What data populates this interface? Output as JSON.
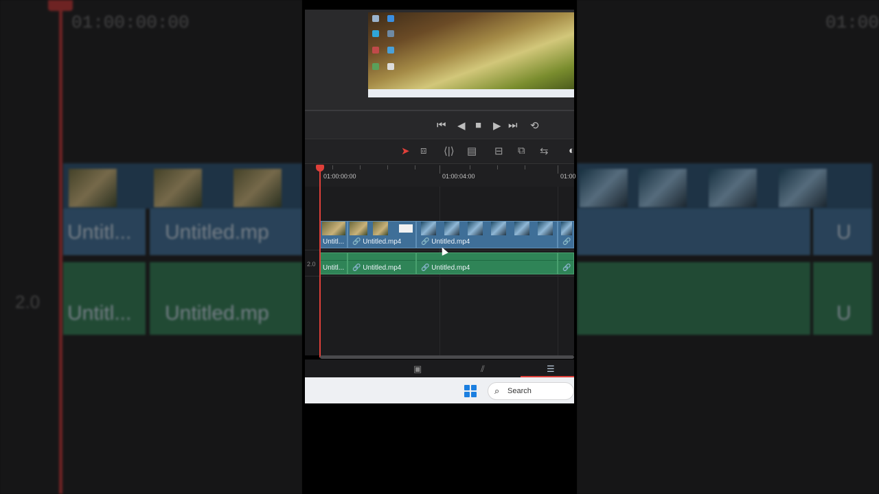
{
  "background": {
    "timecode_left": "01:00:00:00",
    "timecode_right": "01:00",
    "clip_label_1": "Untitl...",
    "clip_label_2": "Untitled.mp",
    "clip_label_right": "U",
    "track_num": "2.0"
  },
  "transport": {
    "icons": [
      "skip-back-icon",
      "prev-frame-icon",
      "stop-icon",
      "play-icon",
      "skip-forward-icon",
      "loop-icon"
    ]
  },
  "ruler": {
    "tc1": "01:00:00:00",
    "tc2": "01:00:04:00",
    "tc3": "01:00"
  },
  "timeline": {
    "audio_track_label": "2.0",
    "video_clips": [
      {
        "label": "Untitl..."
      },
      {
        "label": "Untitled.mp4"
      },
      {
        "label": "Untitled.mp4"
      },
      {
        "label": "U"
      }
    ],
    "audio_clips": [
      {
        "label": "Untitl..."
      },
      {
        "label": "Untitled.mp4"
      },
      {
        "label": "Untitled.mp4"
      },
      {
        "label": "U"
      }
    ]
  },
  "taskbar": {
    "search_placeholder": "Search"
  },
  "colors": {
    "playhead": "#e0403a",
    "video_clip": "#3f6f98",
    "audio_clip": "#2f8457"
  }
}
